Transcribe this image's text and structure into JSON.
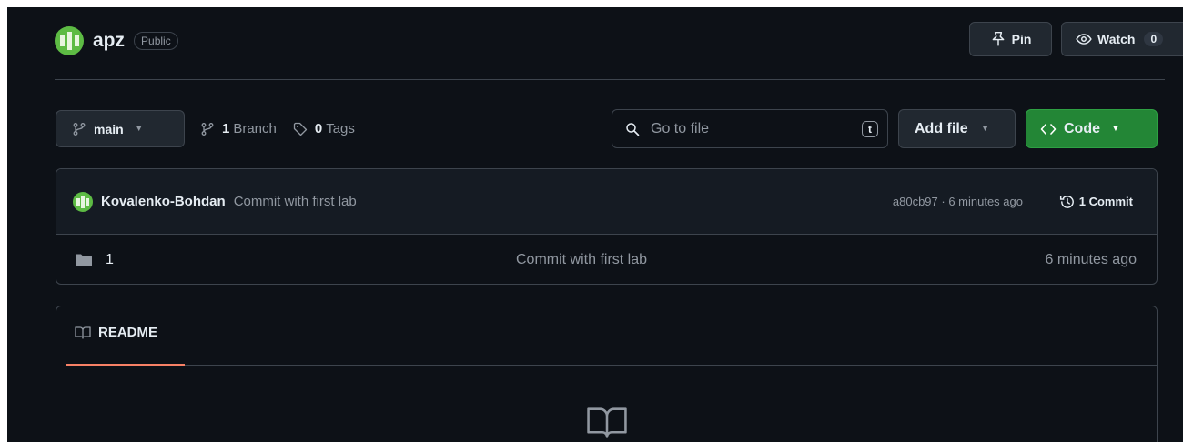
{
  "repo": {
    "name": "apz",
    "visibility": "Public"
  },
  "actions": {
    "pin_label": "Pin",
    "watch_label": "Watch",
    "watch_count": "0"
  },
  "toolbar": {
    "branch": "main",
    "branch_count": "1",
    "branch_label": "Branch",
    "tag_count": "0",
    "tag_label": "Tags",
    "search_placeholder": "Go to file",
    "search_shortcut": "t",
    "add_file_label": "Add file",
    "code_label": "Code"
  },
  "commit": {
    "author": "Kovalenko-Bohdan",
    "message": "Commit with first lab",
    "hash_time": "a80cb97 · 6 minutes ago",
    "count_label": "1 Commit"
  },
  "files": [
    {
      "name": "1",
      "message": "Commit with first lab",
      "age": "6 minutes ago",
      "icon": "folder-icon"
    }
  ],
  "readme": {
    "tab_label": "README"
  },
  "colors": {
    "accent_green": "#238636",
    "tab_underline": "#f78166",
    "background": "#0d1117"
  }
}
